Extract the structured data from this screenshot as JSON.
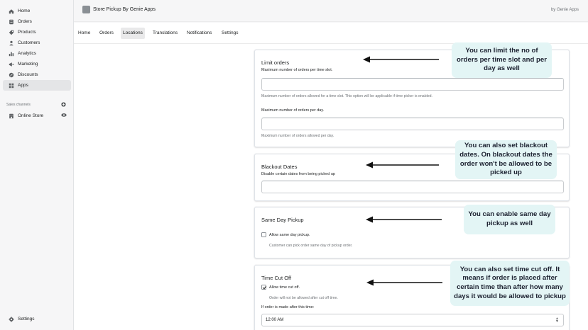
{
  "sidebar": {
    "items": [
      {
        "label": "Home",
        "icon": "home-icon"
      },
      {
        "label": "Orders",
        "icon": "orders-icon"
      },
      {
        "label": "Products",
        "icon": "products-icon"
      },
      {
        "label": "Customers",
        "icon": "customers-icon"
      },
      {
        "label": "Analytics",
        "icon": "analytics-icon"
      },
      {
        "label": "Marketing",
        "icon": "marketing-icon"
      },
      {
        "label": "Discounts",
        "icon": "discounts-icon"
      },
      {
        "label": "Apps",
        "icon": "apps-icon",
        "active": true
      }
    ],
    "sales_channels_title": "Sales channels",
    "online_store": "Online Store",
    "settings": "Settings"
  },
  "header": {
    "app_title": "Store Pickup By Genie Apps",
    "by_label": "by Genie Apps"
  },
  "tabs": [
    {
      "label": "Home"
    },
    {
      "label": "Orders"
    },
    {
      "label": "Locations",
      "active": true
    },
    {
      "label": "Translations"
    },
    {
      "label": "Notifications"
    },
    {
      "label": "Settings"
    }
  ],
  "limit_orders": {
    "title": "Limit orders",
    "per_slot_label": "Maximum number of orders per time slot.",
    "per_slot_help": "Maximum number of orders allowed for a time slot. This option will be applicable if time picker is enabled.",
    "per_day_label": "Maximum number of orders per day.",
    "per_day_help": "Maximum number of orders allowed per day."
  },
  "blackout": {
    "title": "Blackout Dates",
    "subtitle": "Disable certain dates from being picked up"
  },
  "same_day": {
    "title": "Same Day Pickup",
    "checkbox_label": "Allow same day pickup.",
    "checked": false,
    "help": "Customer can pick order same day of pickup order."
  },
  "cutoff": {
    "title": "Time Cut Off",
    "checkbox_label": "Allow time cut off.",
    "checked": true,
    "help": "Order will not be allowed after cut off time.",
    "select_label": "If order is made after this time:",
    "select_value": "12:00 AM"
  },
  "annotations": {
    "limit": "You can limit the no of orders per time slot and per day as well",
    "blackout": "You can also set blackout dates. On blackout dates the order won't be allowed to be picked up",
    "same_day": "You can enable same day pickup as well",
    "cutoff": "You can also set time cut off. It means if order is placed after certain time than after how many days it would be allowed to pickup"
  },
  "colors": {
    "bubble_bg": "#e3f5f5",
    "arrow": "#111111"
  }
}
